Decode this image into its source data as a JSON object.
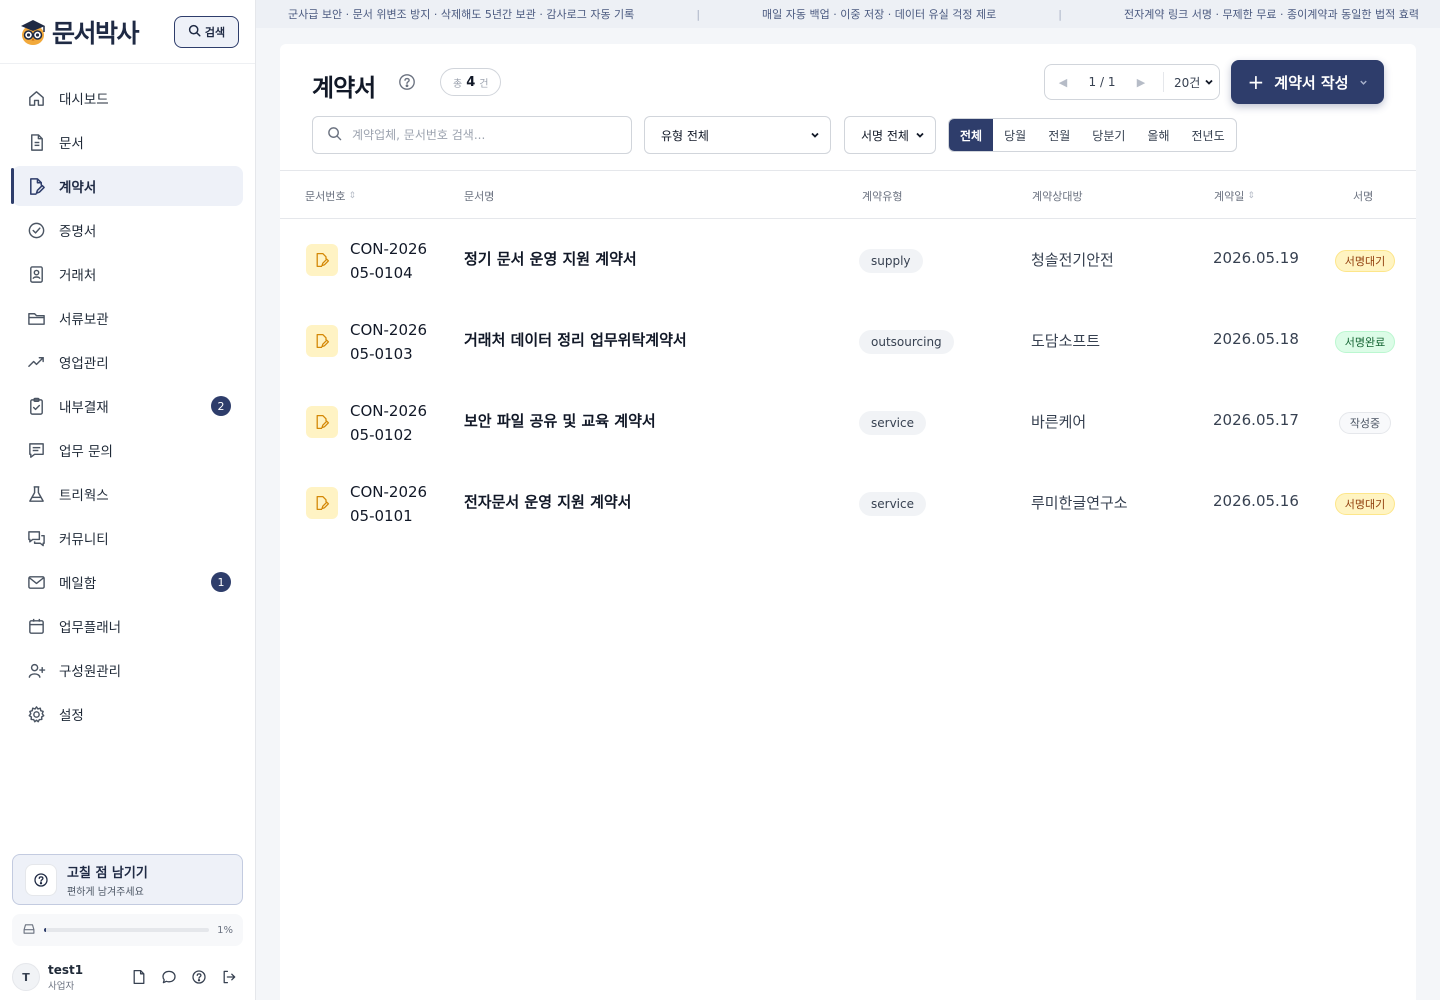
{
  "brand": {
    "name": "문서박사"
  },
  "sidebar": {
    "search_label": "검색",
    "items": [
      {
        "label": "대시보드",
        "icon": "home-icon",
        "active": false
      },
      {
        "label": "문서",
        "icon": "document-icon",
        "active": false
      },
      {
        "label": "계약서",
        "icon": "contract-edit-icon",
        "active": true
      },
      {
        "label": "증명서",
        "icon": "check-circle-icon",
        "active": false
      },
      {
        "label": "거래처",
        "icon": "contact-card-icon",
        "active": false
      },
      {
        "label": "서류보관",
        "icon": "folder-icon",
        "active": false
      },
      {
        "label": "영업관리",
        "icon": "trend-icon",
        "active": false
      },
      {
        "label": "내부결재",
        "icon": "clipboard-check-icon",
        "active": false,
        "badge": "2"
      },
      {
        "label": "업무 문의",
        "icon": "message-lines-icon",
        "active": false
      },
      {
        "label": "트리웍스",
        "icon": "flask-icon",
        "active": false
      },
      {
        "label": "커뮤니티",
        "icon": "chat-bubbles-icon",
        "active": false
      },
      {
        "label": "메일함",
        "icon": "mail-icon",
        "active": false,
        "badge": "1"
      },
      {
        "label": "업무플래너",
        "icon": "calendar-icon",
        "active": false
      },
      {
        "label": "구성원관리",
        "icon": "user-plus-icon",
        "active": false
      },
      {
        "label": "설정",
        "icon": "gear-icon",
        "active": false
      }
    ],
    "feedback": {
      "title": "고칠 점 남기기",
      "subtitle": "편하게 남겨주세요"
    },
    "storage": {
      "percent_label": "1%",
      "fraction": 0.01
    },
    "user": {
      "initial": "T",
      "name": "test1",
      "role": "사업자"
    }
  },
  "banner": [
    "군사급 보안 · 문서 위변조 방지 · 삭제해도 5년간 보관 · 감사로그 자동 기록",
    "매일 자동 백업 · 이중 저장 · 데이터 유실 걱정 제로",
    "전자계약 링크 서명 · 무제한 무료 · 종이계약과 동일한 법적 효력"
  ],
  "banner_separator": "|",
  "page": {
    "title": "계약서",
    "count_prefix": "총",
    "count": "4",
    "count_suffix": "건",
    "pager": {
      "prev": "◀",
      "next": "▶",
      "page": "1 / 1",
      "page_size": "20건"
    },
    "create_button": "계약서 작성",
    "search_placeholder": "계약업체, 문서번호 검색...",
    "type_filter": "유형 전체",
    "sign_filter": "서명 전체",
    "period_tabs": [
      {
        "label": "전체",
        "active": true
      },
      {
        "label": "당월",
        "active": false
      },
      {
        "label": "전월",
        "active": false
      },
      {
        "label": "당분기",
        "active": false
      },
      {
        "label": "올해",
        "active": false
      },
      {
        "label": "전년도",
        "active": false
      }
    ]
  },
  "table": {
    "columns": {
      "doc_no": "문서번호",
      "doc_name": "문서명",
      "type": "계약유형",
      "party": "계약상대방",
      "date": "계약일",
      "sign": "서명"
    },
    "sort_glyph": "⇕",
    "rows": [
      {
        "doc_no": "CON-202605-0104",
        "doc_name": "정기 문서 운영 지원 계약서",
        "type": "supply",
        "party": "청솔전기안전",
        "date": "2026.05.19",
        "sign": "서명대기",
        "sign_status": "wait"
      },
      {
        "doc_no": "CON-202605-0103",
        "doc_name": "거래처 데이터 정리 업무위탁계약서",
        "type": "outsourcing",
        "party": "도담소프트",
        "date": "2026.05.18",
        "sign": "서명완료",
        "sign_status": "done"
      },
      {
        "doc_no": "CON-202605-0102",
        "doc_name": "보안 파일 공유 및 교육 계약서",
        "type": "service",
        "party": "바른케어",
        "date": "2026.05.17",
        "sign": "작성중",
        "sign_status": "draft"
      },
      {
        "doc_no": "CON-202605-0101",
        "doc_name": "전자문서 운영 지원 계약서",
        "type": "service",
        "party": "루미한글연구소",
        "date": "2026.05.16",
        "sign": "서명대기",
        "sign_status": "wait"
      }
    ]
  },
  "colors": {
    "primary": "#2e3d6b",
    "wait": "#fff4c2",
    "done": "#dcfce7",
    "doc_icon_bg": "#fff3c4"
  }
}
